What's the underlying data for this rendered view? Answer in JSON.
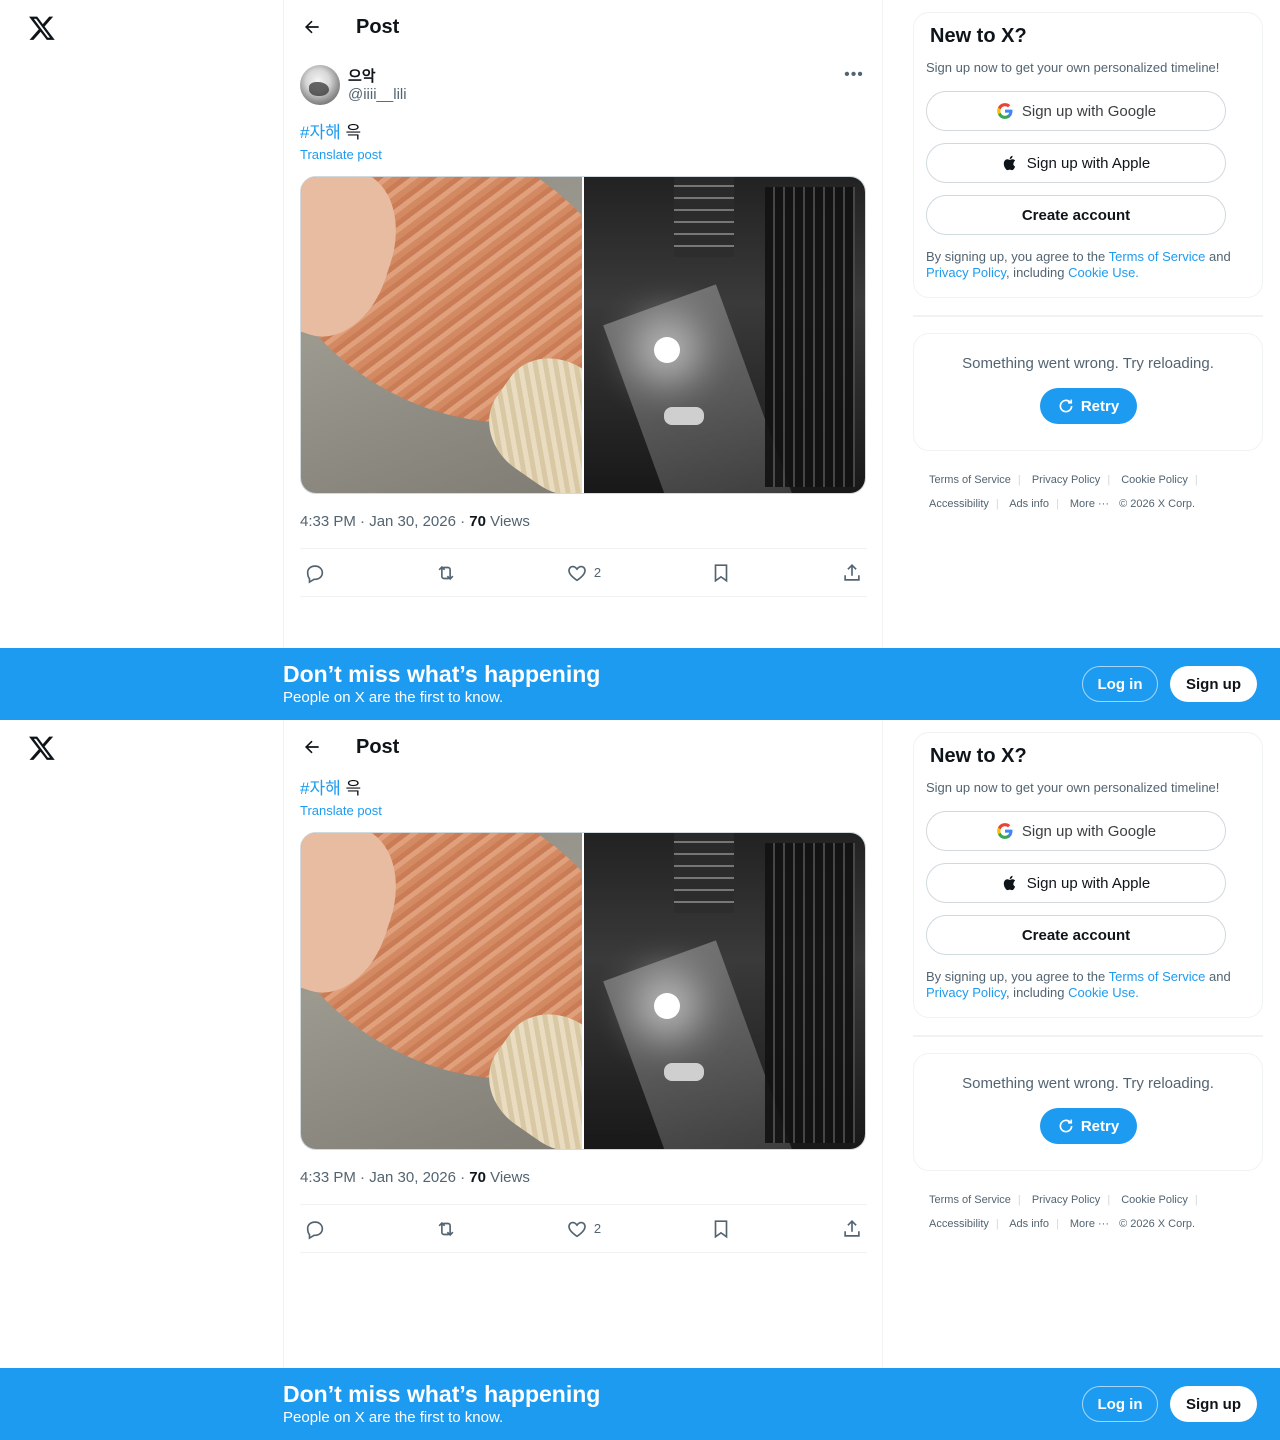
{
  "header": {
    "title": "Post"
  },
  "post": {
    "display_name": "으악",
    "handle": "@iiii__lili",
    "hashtag": "#자해",
    "text_rest": " 윽",
    "translate_label": "Translate post",
    "time": "4:33 PM · Jan 30, 2026 · ",
    "views_count": "70",
    "views_label": " Views",
    "likes": "2"
  },
  "sidebar": {
    "title": "New to X?",
    "subtitle": "Sign up now to get your own personalized timeline!",
    "google_label": "Sign up with Google",
    "apple_label": "Sign up with Apple",
    "create_label": "Create account",
    "legal_pre": "By signing up, you agree to the ",
    "tos_link": "Terms of Service",
    "legal_and": " and ",
    "privacy_link": "Privacy Policy",
    "legal_including": ", including ",
    "cookie_link": "Cookie Use.",
    "error_text": "Something went wrong. Try reloading.",
    "retry_label": "Retry"
  },
  "footer": {
    "terms": "Terms of Service",
    "privacy": "Privacy Policy",
    "cookie": "Cookie Policy",
    "accessibility": "Accessibility",
    "ads": "Ads info",
    "more": "More ···",
    "copyright": "© 2026 X Corp."
  },
  "banner": {
    "title": "Don’t miss what’s happening",
    "subtitle": "People on X are the first to know.",
    "login_label": "Log in",
    "signup_label": "Sign up"
  },
  "colors": {
    "accent": "#1d9bf0",
    "text": "#0f1419",
    "secondary": "#536471"
  },
  "icons": [
    "x-logo-icon",
    "back-arrow-icon",
    "more-dots-icon",
    "reply-icon",
    "repost-icon",
    "like-icon",
    "bookmark-icon",
    "share-icon",
    "google-icon",
    "apple-icon",
    "refresh-icon"
  ]
}
